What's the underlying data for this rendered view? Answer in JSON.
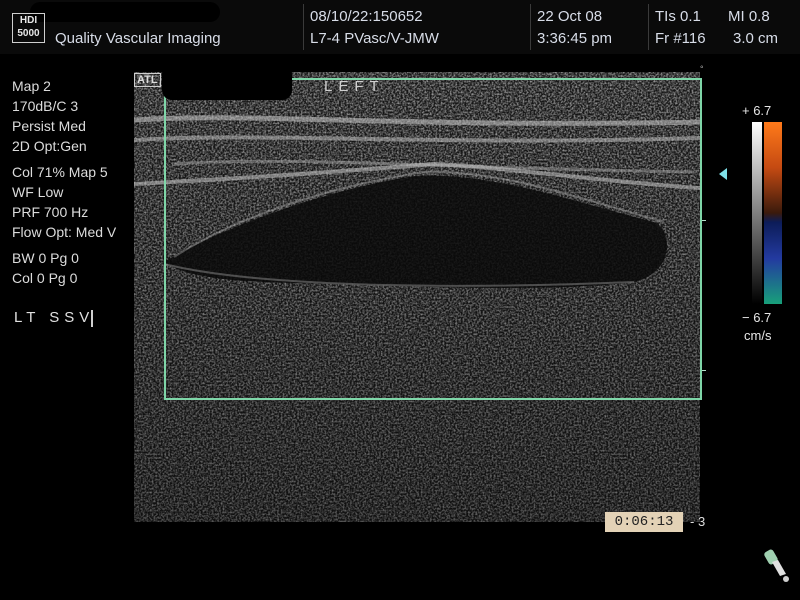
{
  "header": {
    "logo_line1": "HDI",
    "logo_line2": "5000",
    "institution": "Quality Vascular Imaging",
    "study_id": "08/10/22:150652",
    "preset": "L7-4 PVasc/V-JMW",
    "date": "22 Oct 08",
    "time": "3:36:45 pm",
    "tis": "TIs 0.1",
    "mi": "MI 0.8",
    "frame": "Fr #116",
    "depth": "3.0 cm"
  },
  "left_panel": {
    "group1": [
      "Map 2",
      "170dB/C 3",
      "Persist Med",
      "2D Opt:Gen"
    ],
    "group2": [
      "Col 71%  Map 5",
      "WF Low",
      "PRF 700   Hz",
      "Flow Opt: Med V"
    ],
    "group3": [
      "BW 0    Pg 0",
      "Col 0    Pg 0"
    ],
    "annotation": "LT  SSV"
  },
  "image": {
    "al_logo": "ATL",
    "side_label": "LEFT",
    "timer": "0:06:13",
    "depth_label_bottom": "3"
  },
  "color_scale": {
    "top_value": "+ 6.7",
    "bottom_value": "− 6.7",
    "unit": "cm/s",
    "colors": {
      "positive": "#ff7a1a",
      "negative": "#18a07a",
      "box_outline": "#7fd6a8"
    }
  },
  "icons": [
    "probe-icon",
    "depth-marker-arrow-icon"
  ]
}
